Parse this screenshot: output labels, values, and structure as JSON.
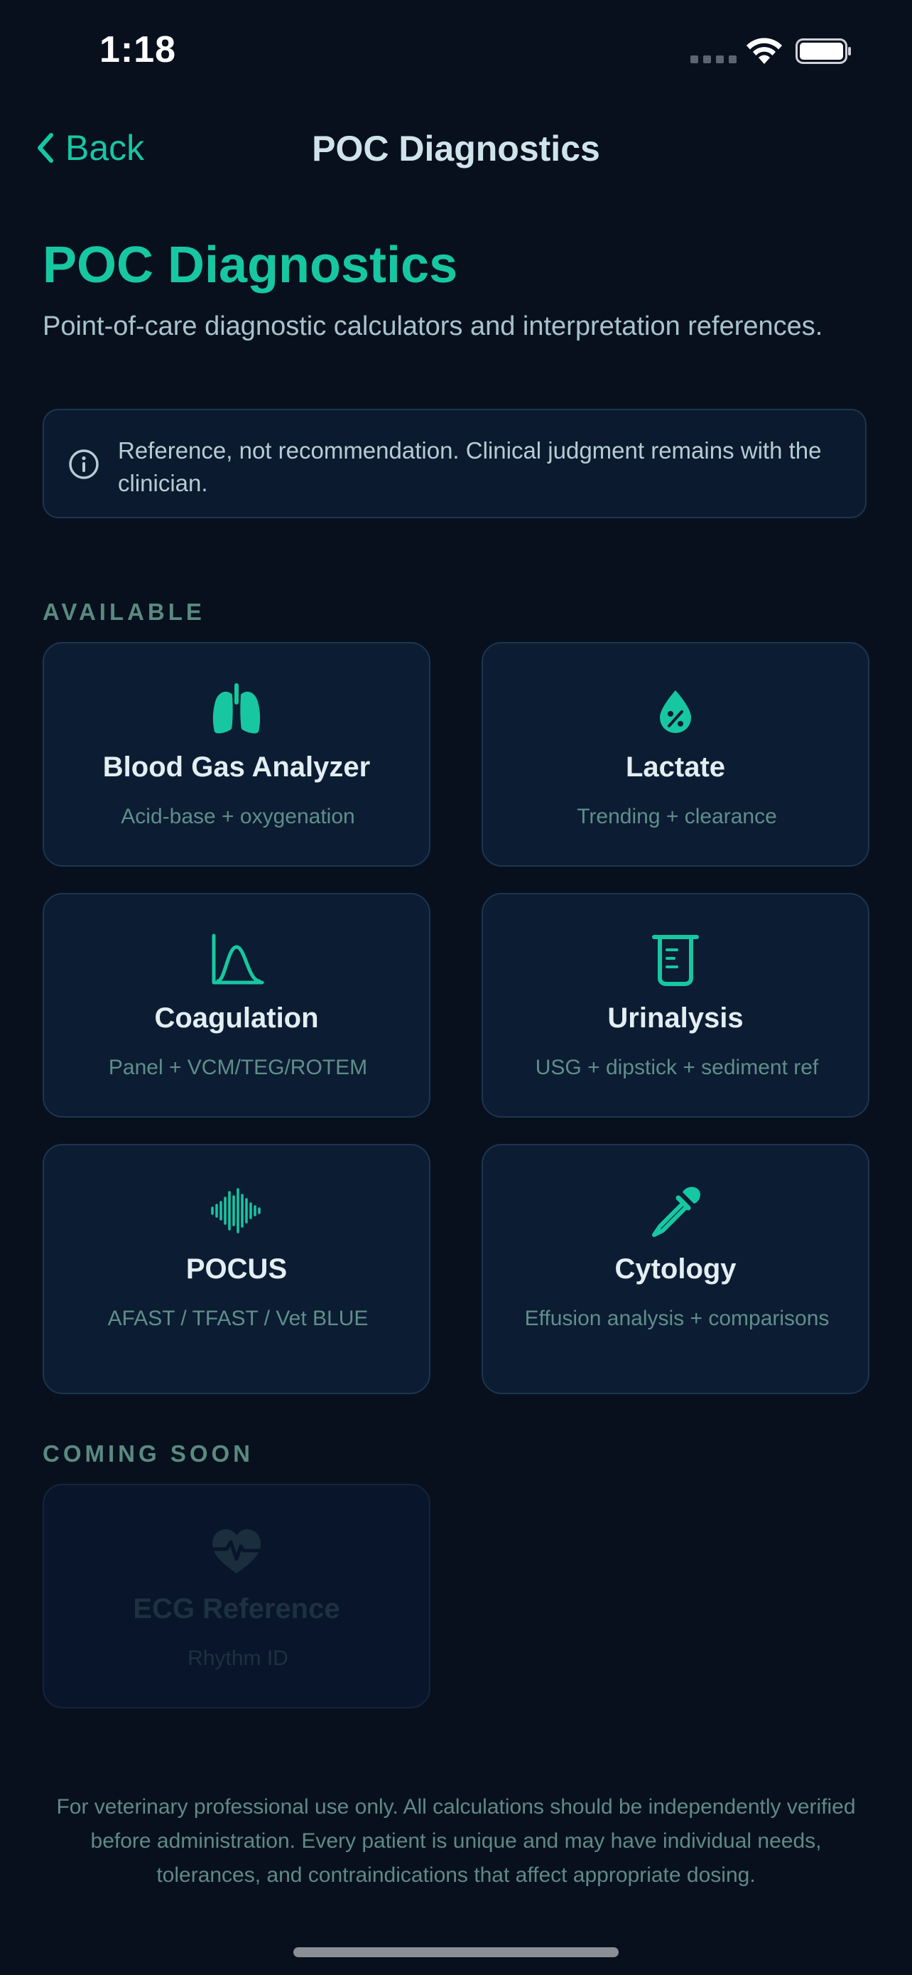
{
  "status_bar": {
    "time": "1:18"
  },
  "nav": {
    "back_label": "Back",
    "title": "POC Diagnostics"
  },
  "header": {
    "title": "POC Diagnostics",
    "subtitle": "Point-of-care diagnostic calculators and interpretation references."
  },
  "notice": {
    "text": "Reference, not recommendation. Clinical judgment remains with the clinician."
  },
  "sections": {
    "available": "AVAILABLE",
    "coming_soon": "COMING SOON"
  },
  "tiles": [
    {
      "title": "Blood Gas Analyzer",
      "subtitle": "Acid-base + oxygenation",
      "icon": "lungs-icon"
    },
    {
      "title": "Lactate",
      "subtitle": "Trending + clearance",
      "icon": "droplet-percent-icon"
    },
    {
      "title": "Coagulation",
      "subtitle": "Panel + VCM/TEG/ROTEM",
      "icon": "bell-curve-chart-icon"
    },
    {
      "title": "Urinalysis",
      "subtitle": "USG + dipstick + sediment ref",
      "icon": "beaker-icon"
    },
    {
      "title": "POCUS",
      "subtitle": "AFAST / TFAST / Vet BLUE",
      "icon": "waveform-icon"
    },
    {
      "title": "Cytology",
      "subtitle": "Effusion analysis + comparisons",
      "icon": "dropper-icon"
    }
  ],
  "coming_soon_tiles": [
    {
      "title": "ECG Reference",
      "subtitle": "Rhythm ID",
      "icon": "heart-pulse-icon"
    }
  ],
  "footer": {
    "text": "For veterinary professional use only. All calculations should be independently verified before administration. Every patient is unique and may have individual needs, tolerances, and contraindications that affect appropriate dosing."
  },
  "colors": {
    "background": "#08101e",
    "accent": "#17c7a2",
    "card": "#0c1c33",
    "card_border": "#1d3550"
  }
}
